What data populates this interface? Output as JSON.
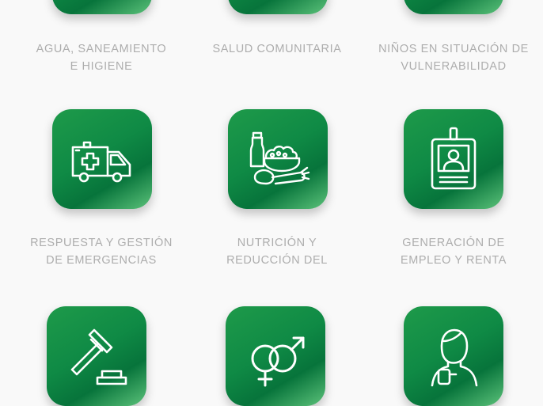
{
  "categories": [
    {
      "line1": "AGUA, SANEAMIENTO",
      "line2": "E HIGIENE",
      "icon": "water-icon"
    },
    {
      "line1": "SALUD COMUNITARIA",
      "line2": "",
      "icon": "health-icon"
    },
    {
      "line1": "NIÑOS EN SITUACIÓN DE",
      "line2": "VULNERABILIDAD",
      "icon": "children-icon"
    },
    {
      "line1": "RESPUESTA Y GESTIÓN",
      "line2": "DE EMERGENCIAS",
      "icon": "ambulance-icon"
    },
    {
      "line1": "NUTRICIÓN Y",
      "line2": "REDUCCIÓN DEL",
      "icon": "food-icon"
    },
    {
      "line1": "GENERACIÓN DE",
      "line2": "EMPLEO Y RENTA",
      "icon": "id-badge-icon"
    },
    {
      "line1": "",
      "line2": "",
      "icon": "gavel-icon"
    },
    {
      "line1": "",
      "line2": "",
      "icon": "gender-icon"
    },
    {
      "line1": "",
      "line2": "",
      "icon": "person-icon"
    }
  ],
  "colors": {
    "tile_dark": "#07743b",
    "tile_light": "#5cc27a",
    "label": "#adadad",
    "background": "#f9f9f9"
  }
}
